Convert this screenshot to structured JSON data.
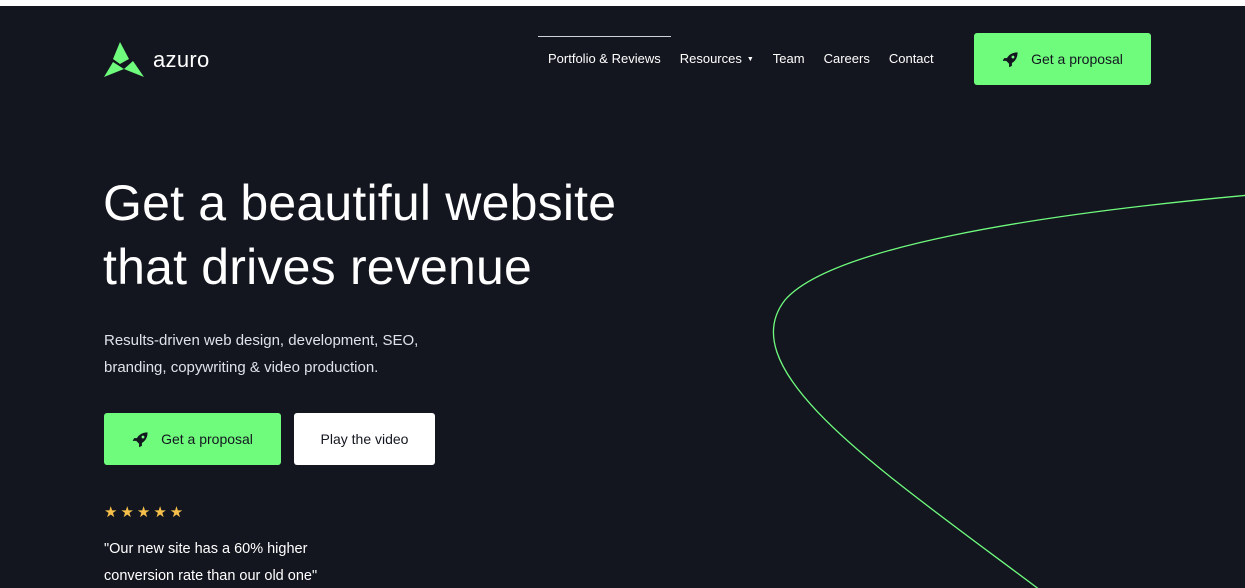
{
  "colors": {
    "background": "#13161f",
    "accent": "#6ffc7d",
    "star": "#f6c04a",
    "text": "#ffffff"
  },
  "header": {
    "brand": "azuro",
    "logo_icon": "azuro-logo-icon",
    "nav": [
      {
        "label": "Portfolio & Reviews",
        "active": true
      },
      {
        "label": "Resources",
        "has_dropdown": true
      },
      {
        "label": "Team"
      },
      {
        "label": "Careers"
      },
      {
        "label": "Contact"
      }
    ],
    "cta": {
      "label": "Get a proposal",
      "icon": "rocket-icon"
    }
  },
  "hero": {
    "title_lines": [
      "Get a beautiful website",
      "that drives revenue"
    ],
    "subtitle_lines": [
      "Results-driven web design, development, SEO,",
      "branding, copywriting & video production."
    ],
    "primary_button": {
      "label": "Get a proposal",
      "icon": "rocket-icon"
    },
    "secondary_button": {
      "label": "Play the video"
    },
    "rating": {
      "stars": 5,
      "text": "★★★★★"
    },
    "testimonial_lines": [
      "\"Our new site has a 60% higher",
      "conversion rate than our old one\""
    ]
  },
  "decoration": {
    "curve_icon": "decorative-curve-line"
  }
}
